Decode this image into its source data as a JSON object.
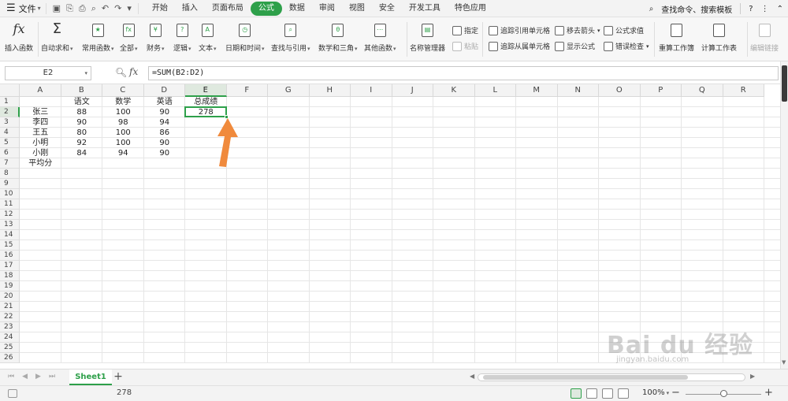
{
  "menubar": {
    "file_label": "文件",
    "tabs": [
      {
        "label": "开始"
      },
      {
        "label": "插入"
      },
      {
        "label": "页面布局"
      },
      {
        "label": "公式"
      },
      {
        "label": "数据"
      },
      {
        "label": "审阅"
      },
      {
        "label": "视图"
      },
      {
        "label": "安全"
      },
      {
        "label": "开发工具"
      },
      {
        "label": "特色应用"
      }
    ],
    "active_tab": "公式",
    "search_label": "查找命令、搜索模板",
    "help_glyph": "?",
    "accent_color": "#2ea04a"
  },
  "ribbon": {
    "buttons": [
      {
        "label": "插入函数",
        "icon": "fx-icon",
        "glyph": "fx"
      },
      {
        "label": "自动求和",
        "icon": "sigma-icon",
        "glyph": "Σ",
        "caret": true
      },
      {
        "label": "常用函数",
        "icon": "star-function-icon",
        "glyph": "★",
        "caret": true
      },
      {
        "label": "全部",
        "icon": "all-functions-icon",
        "glyph": "fx",
        "caret": true
      },
      {
        "label": "财务",
        "icon": "finance-icon",
        "glyph": "¥",
        "caret": true
      },
      {
        "label": "逻辑",
        "icon": "logic-icon",
        "glyph": "?",
        "caret": true
      },
      {
        "label": "文本",
        "icon": "text-icon",
        "glyph": "A",
        "caret": true
      },
      {
        "label": "日期和时间",
        "icon": "datetime-icon",
        "glyph": "◷",
        "caret": true
      },
      {
        "label": "查找与引用",
        "icon": "lookup-icon",
        "glyph": "⌕",
        "caret": true
      },
      {
        "label": "数学和三角",
        "icon": "math-icon",
        "glyph": "θ",
        "caret": true
      },
      {
        "label": "其他函数",
        "icon": "more-functions-icon",
        "glyph": "⋯",
        "caret": true
      },
      {
        "label": "名称管理器",
        "icon": "name-manager-icon",
        "glyph": "▤"
      }
    ],
    "small_buttons": [
      {
        "label": "指定",
        "icon": "assign-icon"
      },
      {
        "label": "粘贴",
        "icon": "paste-icon",
        "disabled": true
      },
      {
        "label": "追踪引用单元格",
        "icon": "trace-precedents-icon"
      },
      {
        "label": "追踪从属单元格",
        "icon": "trace-dependents-icon"
      },
      {
        "label": "移去箭头",
        "icon": "remove-arrows-icon",
        "caret": true
      },
      {
        "label": "显示公式",
        "icon": "show-formulas-icon"
      },
      {
        "label": "公式求值",
        "icon": "evaluate-formula-icon"
      },
      {
        "label": "错误检查",
        "icon": "error-check-icon",
        "caret": true
      }
    ],
    "calc_buttons": [
      {
        "label": "重算工作簿",
        "icon": "recalc-workbook-icon"
      },
      {
        "label": "计算工作表",
        "icon": "calc-sheet-icon"
      },
      {
        "label": "编辑链接",
        "icon": "edit-links-icon",
        "disabled": true
      }
    ]
  },
  "formula_bar": {
    "name_box": "E2",
    "fx_label": "fx",
    "formula": "=SUM(B2:D2)"
  },
  "sheet": {
    "columns": [
      "A",
      "B",
      "C",
      "D",
      "E",
      "F",
      "G",
      "H",
      "I",
      "J",
      "K",
      "L",
      "M",
      "N",
      "O",
      "P",
      "Q",
      "R"
    ],
    "row_count": 26,
    "selected_column": "E",
    "selected_row": 2,
    "rows": [
      [
        "",
        "语文",
        "数学",
        "英语",
        "总成绩"
      ],
      [
        "张三",
        "88",
        "100",
        "90",
        "278"
      ],
      [
        "李四",
        "90",
        "98",
        "94",
        ""
      ],
      [
        "王五",
        "80",
        "100",
        "86",
        ""
      ],
      [
        "小明",
        "92",
        "100",
        "90",
        ""
      ],
      [
        "小刚",
        "84",
        "94",
        "90",
        ""
      ],
      [
        "平均分",
        "",
        "",
        "",
        ""
      ]
    ]
  },
  "sheet_tabs": {
    "tabs": [
      "Sheet1"
    ],
    "add_label": "+"
  },
  "statusbar": {
    "sum_value": "278",
    "zoom": "100%",
    "zoom_fraction": 0.5
  },
  "watermark": {
    "brand": "Bai du 经验",
    "url": "jingyan.baidu.com"
  },
  "annotation": {
    "arrow_color": "#f08a3c"
  }
}
